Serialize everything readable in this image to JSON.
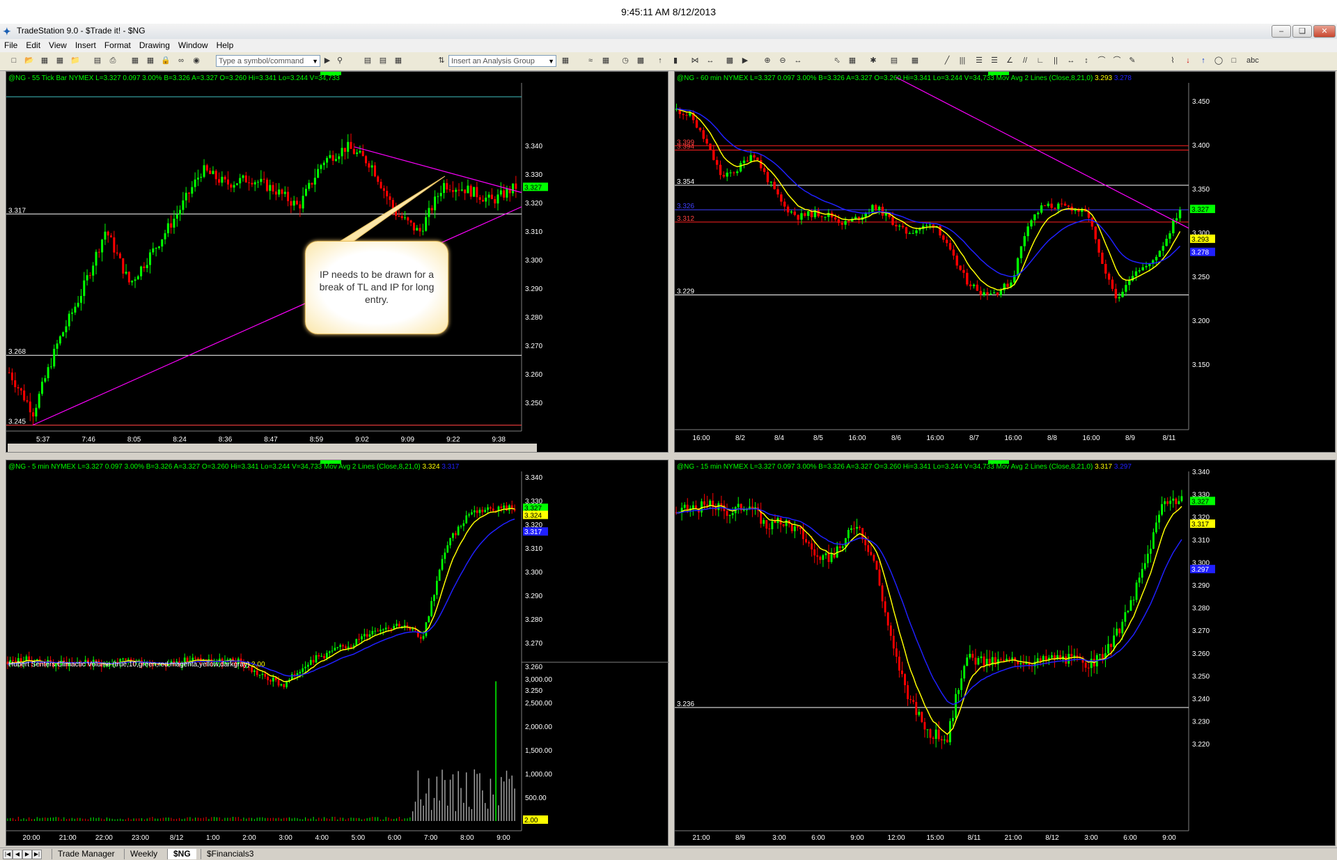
{
  "clock": "9:45:11 AM 8/12/2013",
  "window": {
    "title": "TradeStation 9.0 - $Trade it! - $NG",
    "controls": [
      "minimize",
      "restore",
      "close"
    ]
  },
  "menu": [
    "File",
    "Edit",
    "View",
    "Insert",
    "Format",
    "Drawing",
    "Window",
    "Help"
  ],
  "toolbar": {
    "symbol_placeholder": "Type a symbol/command",
    "analysis_placeholder": "Insert an Analysis Group"
  },
  "annotation": {
    "text": "IP needs to be drawn for a break of TL and IP for long entry."
  },
  "colors": {
    "up": "#00ff00",
    "down": "#ff0000",
    "ma_fast": "#ffff00",
    "ma_slow": "#2020ff",
    "trendline": "#ff00ff",
    "header_text": "#00ff00",
    "label_bg": "#00ff00"
  },
  "charts": [
    {
      "id": "tick",
      "header": "@NG - 55 Tick Bar  NYMEX  L=3.327  0.097  3.00%  B=3.326  A=3.327  O=3.260  Hi=3.341  Lo=3.244  V=34,733",
      "y_ticks": [
        "3.340",
        "3.330",
        "3.320",
        "3.310",
        "3.300",
        "3.290",
        "3.280",
        "3.270",
        "3.260",
        "3.250"
      ],
      "x_ticks": [
        "5:37",
        "7:46",
        "8:05",
        "8:24",
        "8:36",
        "8:47",
        "8:59",
        "9:02",
        "9:09",
        "9:22",
        "9:38"
      ],
      "level_labels": [
        "3.317",
        "3.268",
        "3.245"
      ],
      "last_label": "3.327"
    },
    {
      "id": "60min",
      "header": "@NG - 60 min  NYMEX  L=3.327  0.097  3.00%  B=3.326  A=3.327  O=3.260  Hi=3.341  Lo=3.244  V=34,733  Mov Avg 2 Lines (Close,8,21,0)",
      "ma_values": [
        "3.293",
        "3.278"
      ],
      "y_ticks": [
        "3.450",
        "3.400",
        "3.350",
        "3.300",
        "3.250",
        "3.200",
        "3.150"
      ],
      "x_ticks": [
        "16:00",
        "8/2",
        "8/4",
        "8/5",
        "16:00",
        "8/6",
        "16:00",
        "8/7",
        "16:00",
        "8/8",
        "16:00",
        "8/9",
        "8/11"
      ],
      "level_labels": [
        "3.399",
        "3.394",
        "3.354",
        "3.326",
        "3.312",
        "3.229"
      ],
      "last_label": "3.327",
      "ma_labels": [
        "3.293",
        "3.278"
      ]
    },
    {
      "id": "5min",
      "header": "@NG - 5 min  NYMEX  L=3.327  0.097  3.00%  B=3.326  A=3.327  O=3.260  Hi=3.341  Lo=3.244  V=34,733  Mov Avg 2 Lines (Close,8,21,0)",
      "ma_values": [
        "3.324",
        "3.317"
      ],
      "y_ticks": [
        "3.340",
        "3.330",
        "3.320",
        "3.310",
        "3.300",
        "3.290",
        "3.280",
        "3.270",
        "3.260",
        "3.250"
      ],
      "x_ticks": [
        "20:00",
        "21:00",
        "22:00",
        "23:00",
        "8/12",
        "1:00",
        "2:00",
        "3:00",
        "4:00",
        "5:00",
        "6:00",
        "7:00",
        "8:00",
        "9:00"
      ],
      "last_label": "3.327",
      "ma_labels": [
        "3.324",
        "3.317"
      ],
      "subgraph": {
        "header": "Hubert Senters Climactic Volume (true,10,green,red,magenta,yellow,darkgray)",
        "value": "2.00",
        "y_ticks": [
          "3,000.00",
          "2,500.00",
          "2,000.00",
          "1,500.00",
          "1,000.00",
          "500.00"
        ],
        "last_label": "2.00"
      }
    },
    {
      "id": "15min",
      "header": "@NG - 15 min  NYMEX  L=3.327  0.097  3.00%  B=3.326  A=3.327  O=3.260  Hi=3.341  Lo=3.244  V=34,733  Mov Avg 2 Lines (Close,8,21,0)",
      "ma_values": [
        "3.317",
        "3.297"
      ],
      "y_ticks": [
        "3.340",
        "3.330",
        "3.320",
        "3.310",
        "3.300",
        "3.290",
        "3.280",
        "3.270",
        "3.260",
        "3.250",
        "3.240",
        "3.230",
        "3.220"
      ],
      "x_ticks": [
        "21:00",
        "8/9",
        "3:00",
        "6:00",
        "9:00",
        "12:00",
        "15:00",
        "8/11",
        "21:00",
        "8/12",
        "3:00",
        "6:00",
        "9:00"
      ],
      "level_labels": [
        "3.236"
      ],
      "last_label": "3.327",
      "ma_labels": [
        "3.317",
        "3.297"
      ]
    }
  ],
  "workspace_tabs": [
    "Trade Manager",
    "Weekly",
    "$NG",
    "$Financials3"
  ],
  "active_tab": "$NG"
}
